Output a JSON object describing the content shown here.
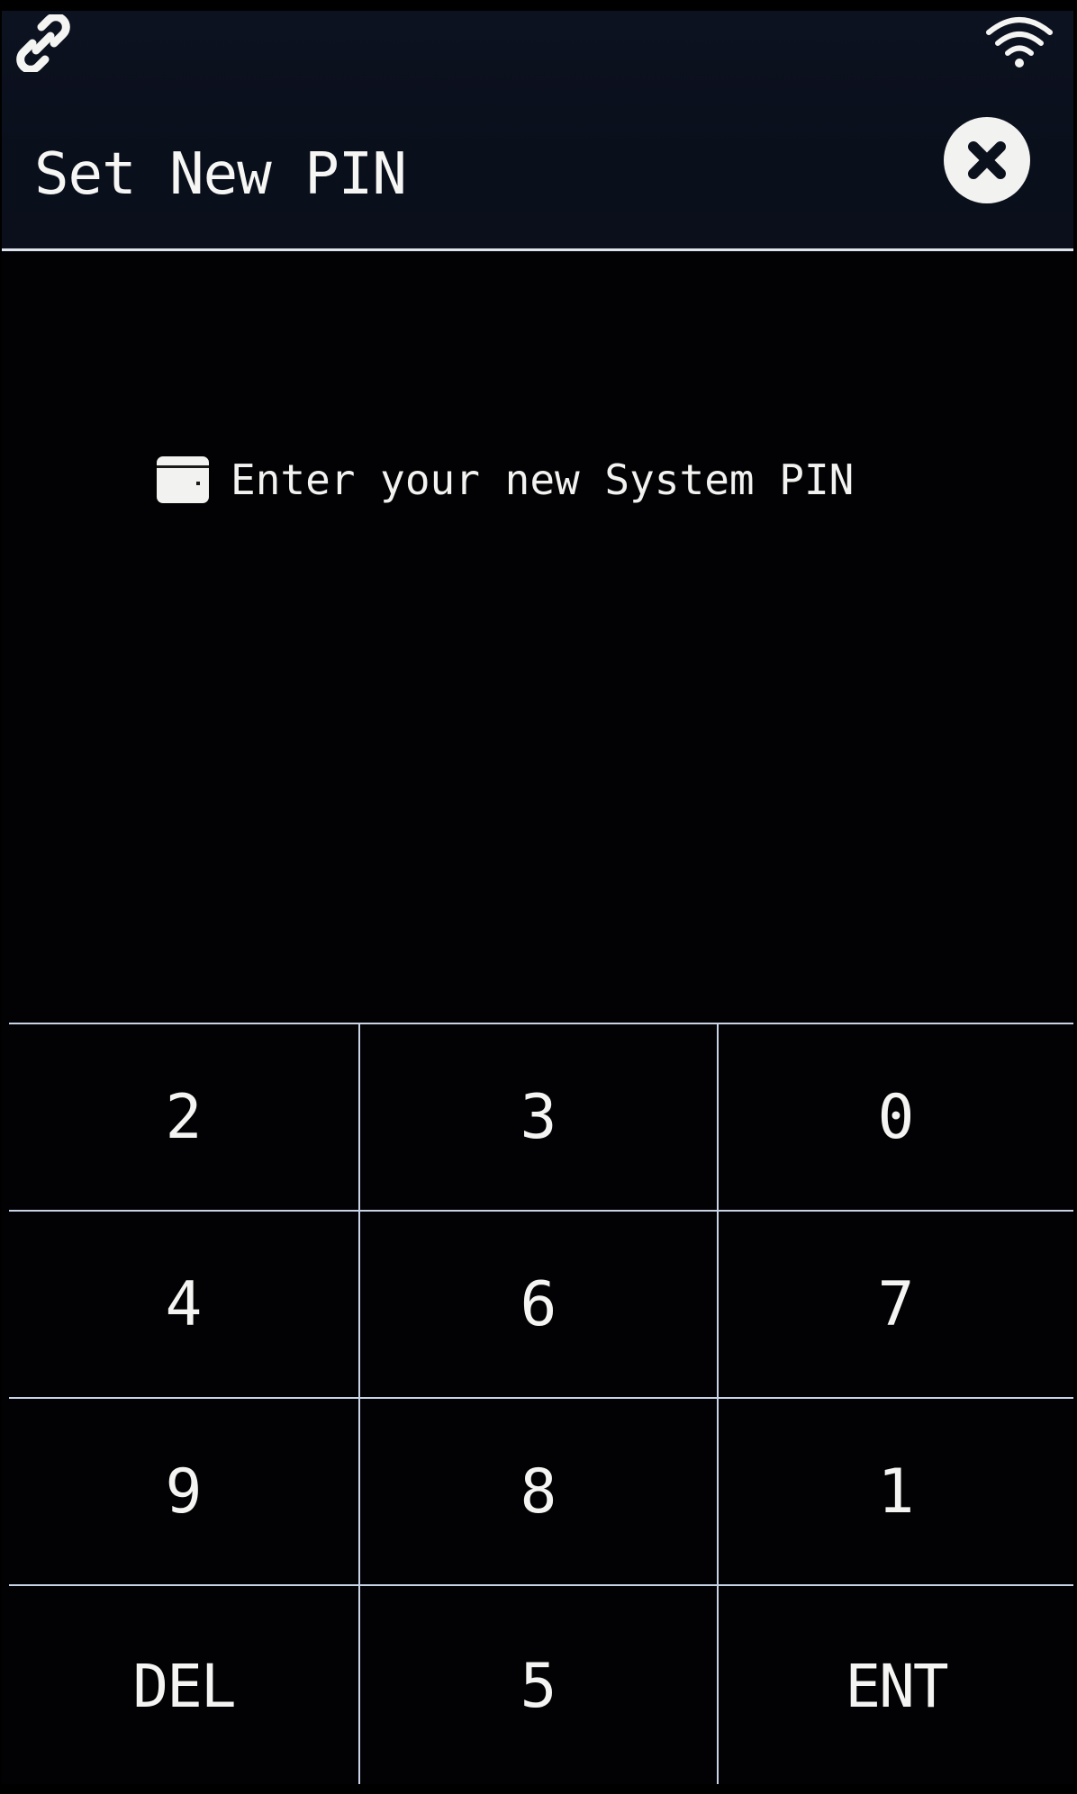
{
  "status_bar": {
    "left_icon": "link-icon",
    "right_icon": "wifi-icon"
  },
  "header": {
    "title": "Set New PIN",
    "close_icon": "close-circle-icon"
  },
  "prompt": {
    "icon": "card-icon",
    "text": "Enter your new System PIN"
  },
  "keypad": {
    "keys": [
      {
        "label": "2"
      },
      {
        "label": "3"
      },
      {
        "label": "0"
      },
      {
        "label": "4"
      },
      {
        "label": "6"
      },
      {
        "label": "7"
      },
      {
        "label": "9"
      },
      {
        "label": "8"
      },
      {
        "label": "1"
      },
      {
        "label": "DEL"
      },
      {
        "label": "5"
      },
      {
        "label": "ENT"
      }
    ]
  },
  "colors": {
    "background": "#000000",
    "header_background": "#0b101d",
    "text": "#f4f4f2",
    "grid_lines": "#c9d3e6"
  }
}
